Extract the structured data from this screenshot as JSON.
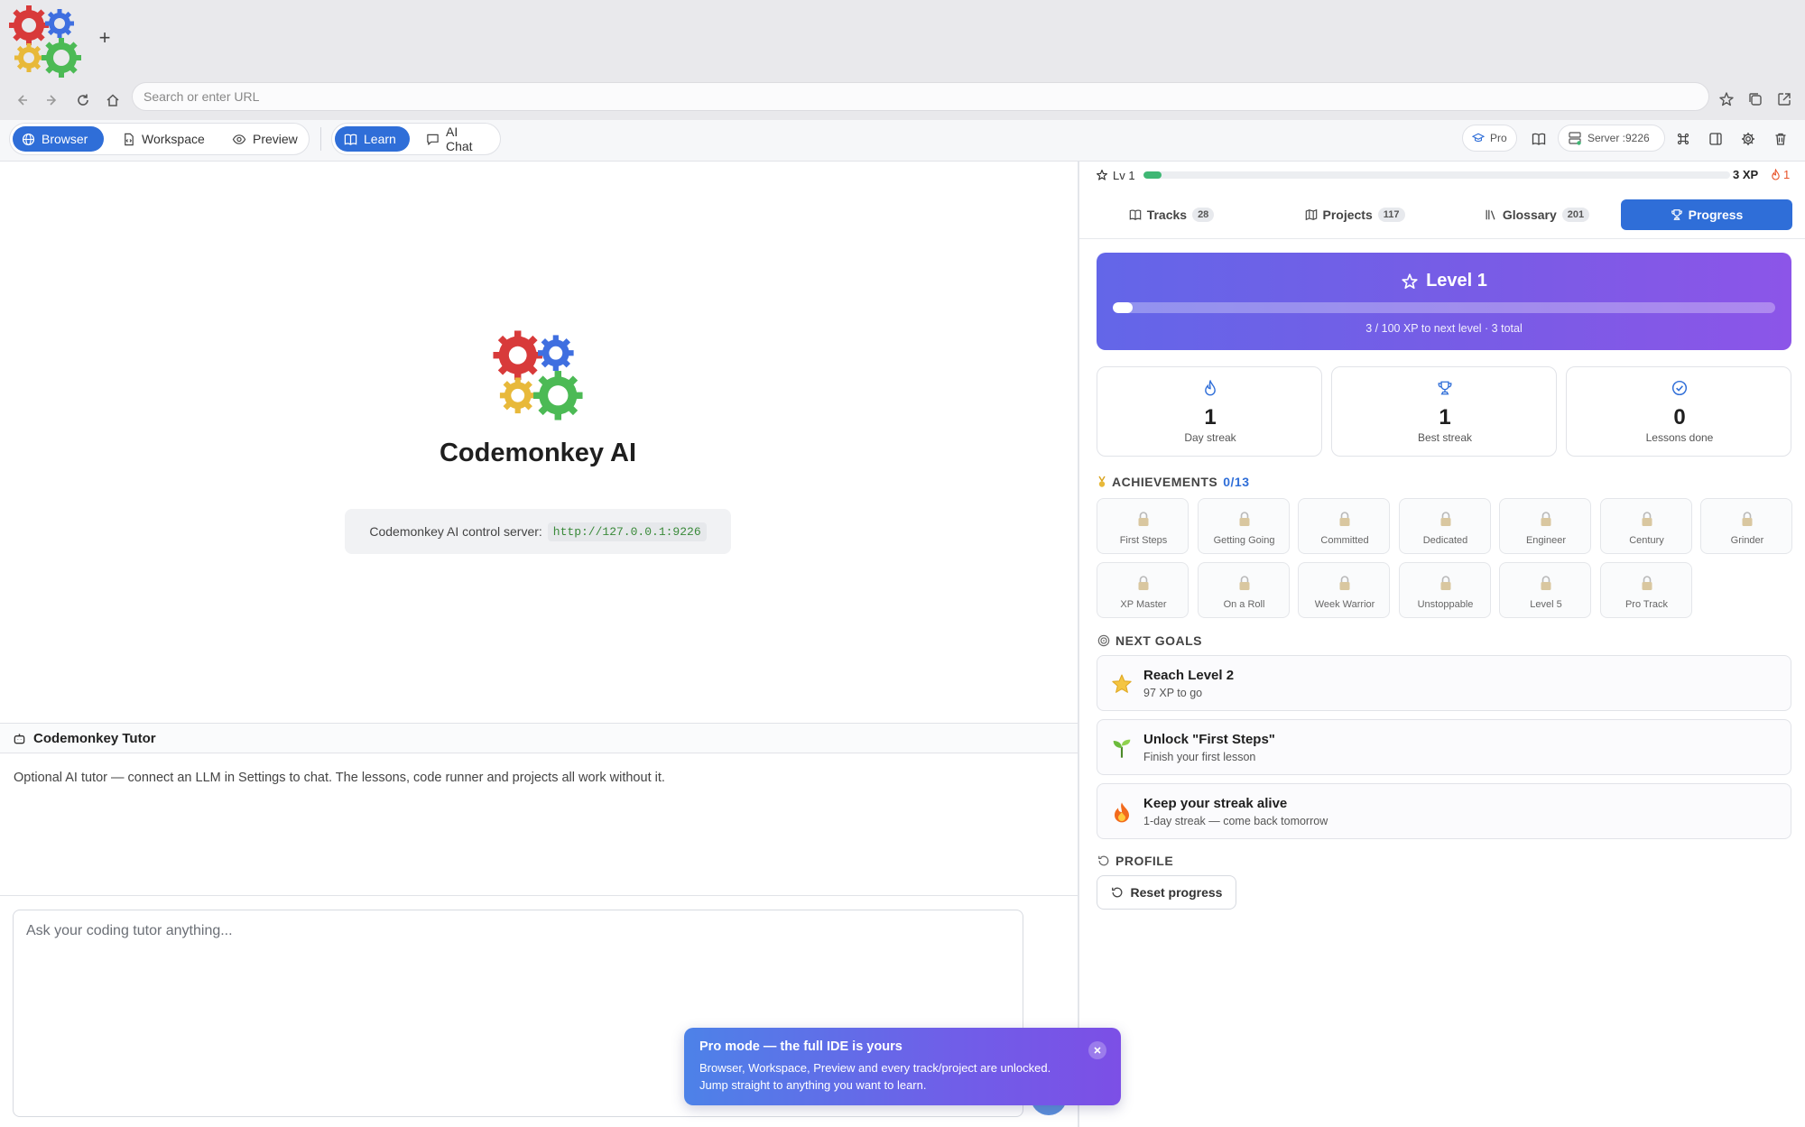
{
  "browser": {
    "new_tab_label": "+",
    "url_placeholder": "Search or enter URL"
  },
  "toolbar": {
    "modes": [
      {
        "label": "Browser",
        "icon": "globe-icon",
        "active": true
      },
      {
        "label": "Workspace",
        "icon": "file-code-icon",
        "active": false
      },
      {
        "label": "Preview",
        "icon": "eye-icon",
        "active": false
      }
    ],
    "tools": [
      {
        "label": "Learn",
        "icon": "book-icon",
        "active": true
      },
      {
        "label": "AI Chat",
        "icon": "chat-icon",
        "active": false
      }
    ],
    "pro_label": "Pro",
    "server_label": "Server :9226"
  },
  "main": {
    "app_name": "Codemonkey AI",
    "server_text": "Codemonkey AI control server:",
    "server_url": "http://127.0.0.1:9226"
  },
  "tutor": {
    "title": "Codemonkey Tutor",
    "description": "Optional AI tutor — connect an LLM in Settings to chat. The lessons, code runner and projects all work without it.",
    "input_placeholder": "Ask your coding tutor anything..."
  },
  "toast": {
    "title": "Pro mode — the full IDE is yours",
    "body": "Browser, Workspace, Preview and every track/project are unlocked. Jump straight to anything you want to learn."
  },
  "progress_panel": {
    "level_short": "Lv 1",
    "xp_label": "3 XP",
    "xp_fraction": 0.03,
    "streak_count": "1",
    "tabs": [
      {
        "label": "Tracks",
        "count": "28",
        "icon": "book-icon",
        "active": false
      },
      {
        "label": "Projects",
        "count": "117",
        "icon": "map-icon",
        "active": false
      },
      {
        "label": "Glossary",
        "count": "201",
        "icon": "library-icon",
        "active": false
      },
      {
        "label": "Progress",
        "count": "",
        "icon": "trophy-icon",
        "active": true
      }
    ],
    "level": {
      "title": "Level 1",
      "subtitle": "3 / 100 XP to next level · 3 total",
      "fraction": 0.03
    },
    "stats": [
      {
        "value": "1",
        "label": "Day streak",
        "icon": "flame-icon"
      },
      {
        "value": "1",
        "label": "Best streak",
        "icon": "trophy-icon"
      },
      {
        "value": "0",
        "label": "Lessons done",
        "icon": "check-circle-icon"
      }
    ],
    "achievements_title": "ACHIEVEMENTS",
    "achievements_count": "0/13",
    "achievements": [
      "First Steps",
      "Getting Going",
      "Committed",
      "Dedicated",
      "Engineer",
      "Century",
      "Grinder",
      "XP Master",
      "On a Roll",
      "Week Warrior",
      "Unstoppable",
      "Level 5",
      "Pro Track"
    ],
    "goals_title": "NEXT GOALS",
    "goals": [
      {
        "title": "Reach Level 2",
        "subtitle": "97 XP to go",
        "icon": "star-icon"
      },
      {
        "title": "Unlock \"First Steps\"",
        "subtitle": "Finish your first lesson",
        "icon": "seedling-icon"
      },
      {
        "title": "Keep your streak alive",
        "subtitle": "1-day streak — come back tomorrow",
        "icon": "fire-icon"
      }
    ],
    "profile_title": "PROFILE",
    "reset_label": "Reset progress"
  },
  "colors": {
    "accent": "#2f6ed8",
    "level_gradient_start": "#6366e8",
    "level_gradient_end": "#8c55e8",
    "xp_green": "#3fb774",
    "streak_orange": "#e8542a"
  }
}
